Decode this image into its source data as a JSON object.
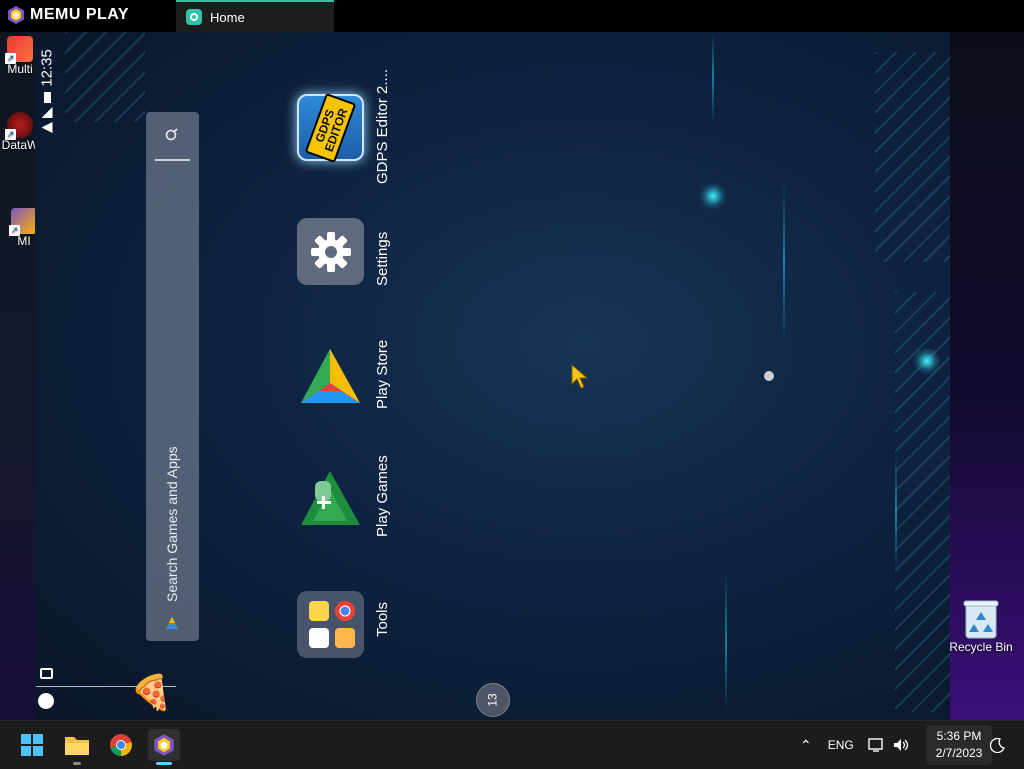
{
  "emulator": {
    "brand": "MEMU PLAY",
    "tab_label": "Home"
  },
  "desktop": {
    "icons": [
      {
        "label": "Multi"
      },
      {
        "label": "DataW"
      },
      {
        "label": "MI"
      }
    ],
    "recycle_bin": "Recycle Bin"
  },
  "android": {
    "status_time": "12:35",
    "search_placeholder": "Search Games and Apps",
    "apps": [
      {
        "label": "GDPS Editor 2....",
        "icon": "gdps-editor-icon",
        "icon_text": "GDPS EDITOR"
      },
      {
        "label": "Settings",
        "icon": "gear-icon"
      },
      {
        "label": "Play Store",
        "icon": "play-store-icon"
      },
      {
        "label": "Play Games",
        "icon": "play-games-icon"
      },
      {
        "label": "Tools",
        "icon": "folder-icon"
      }
    ],
    "page_indicator": "13"
  },
  "taskbar": {
    "apps": [
      "start-icon",
      "file-explorer-icon",
      "chrome-icon",
      "memu-icon"
    ],
    "language": "ENG",
    "time": "5:36 PM",
    "date": "2/7/2023"
  },
  "colors": {
    "accent": "#2ec4a6",
    "android_bg": "#0e2240"
  }
}
